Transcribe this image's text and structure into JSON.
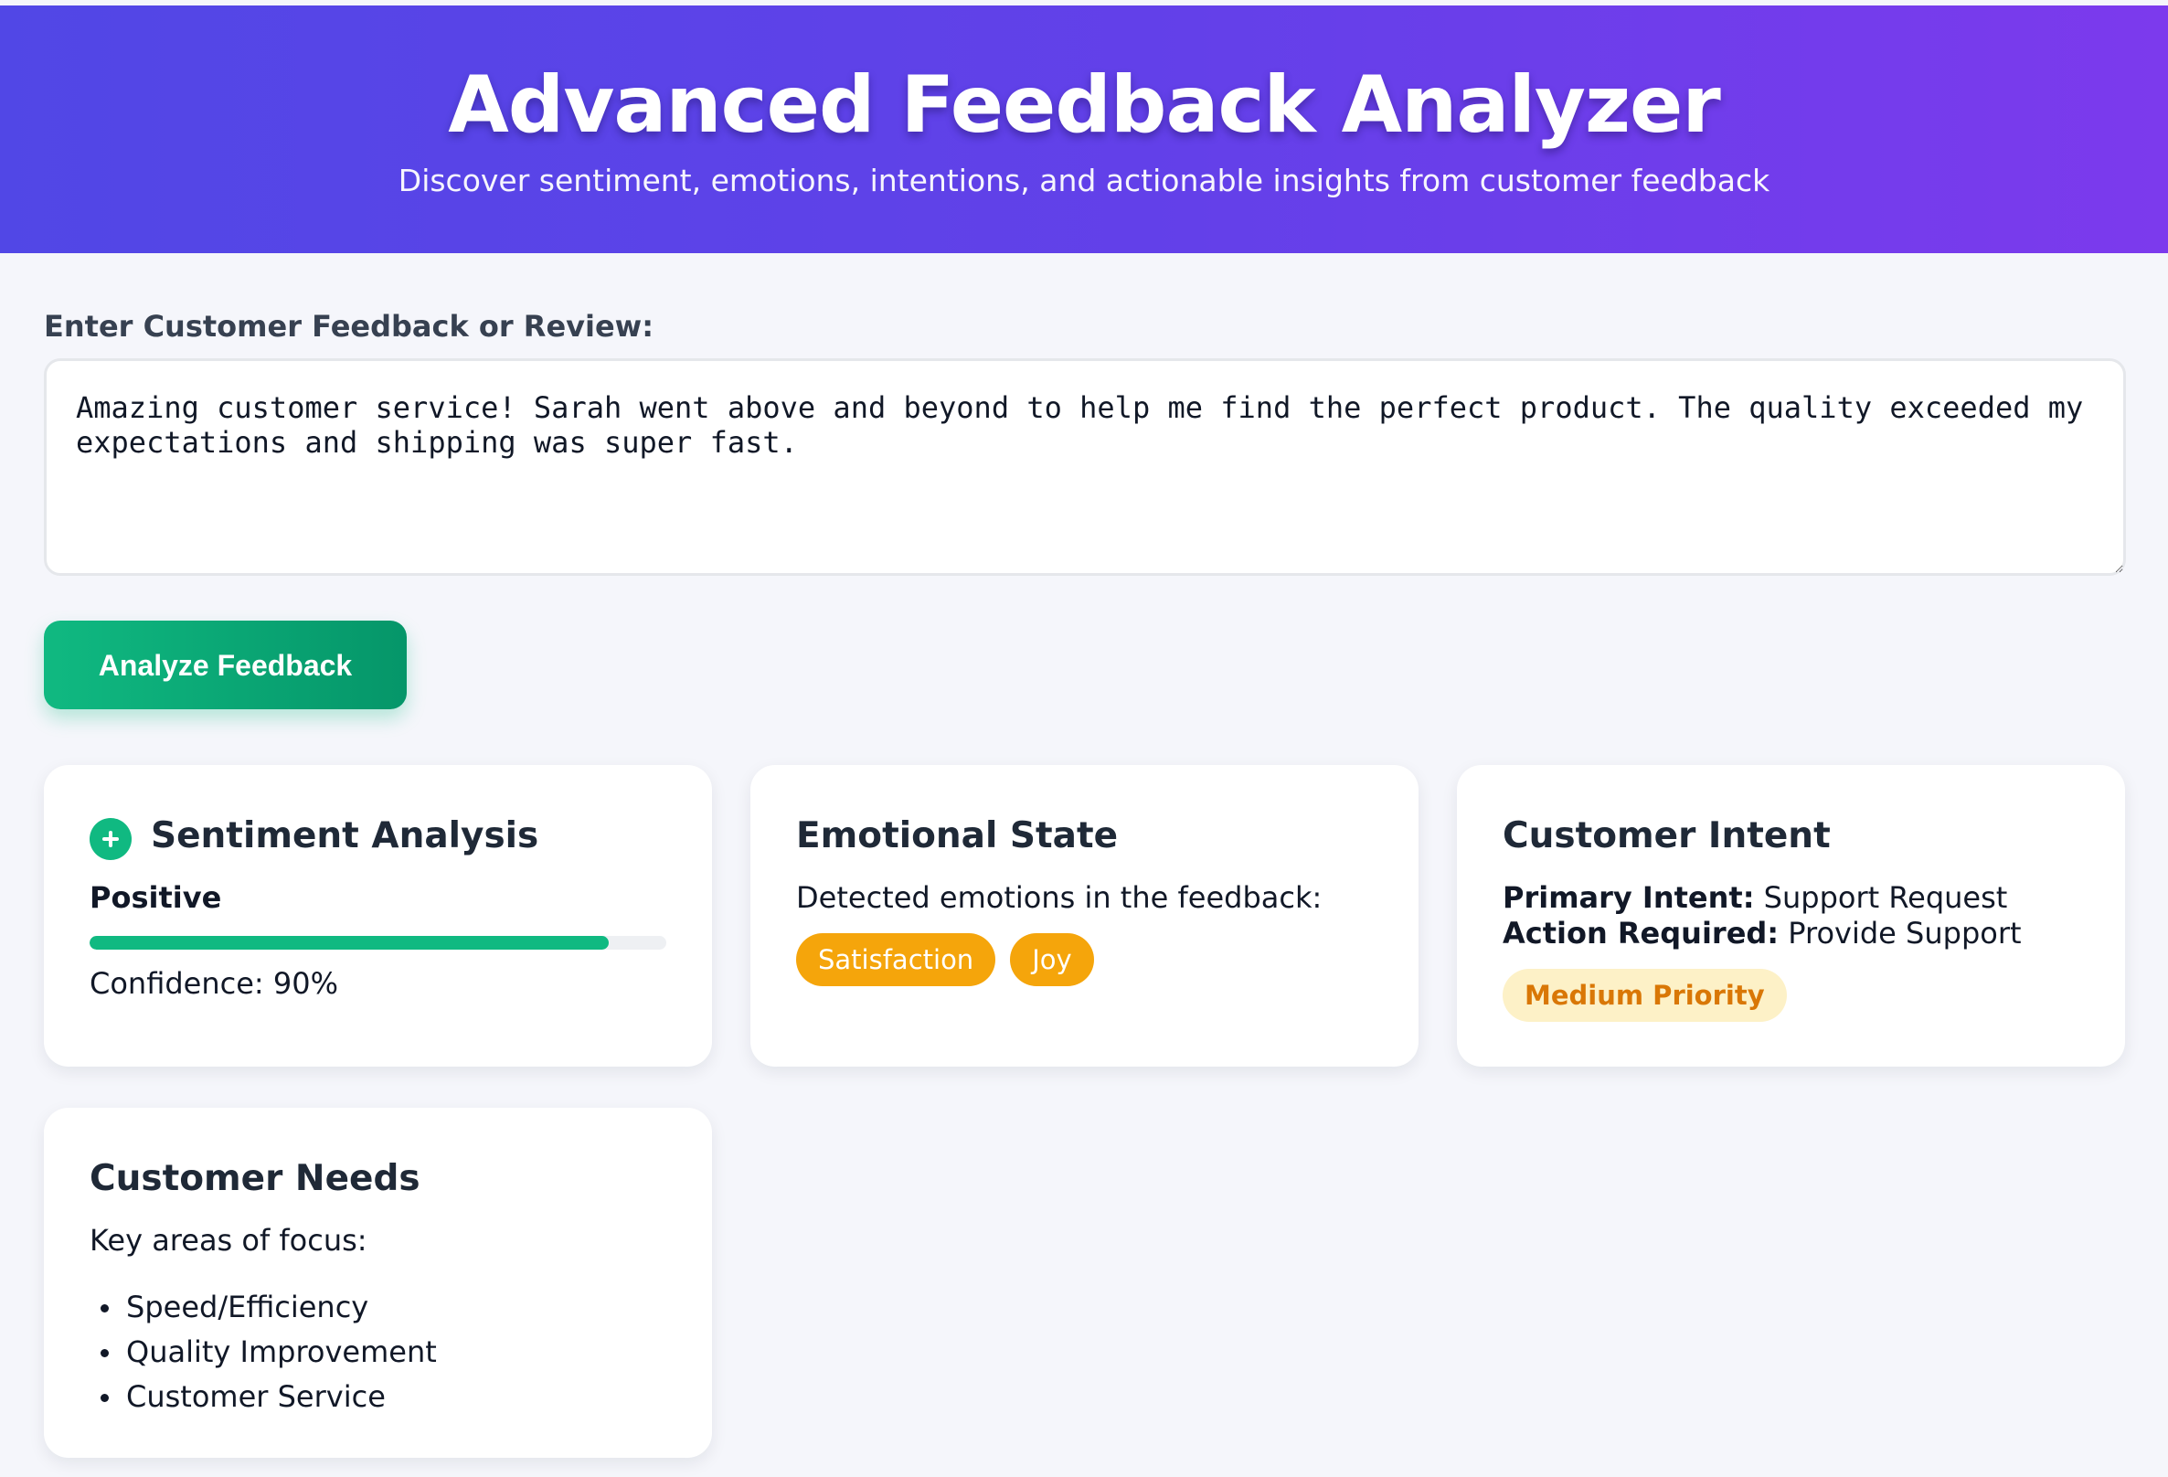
{
  "header": {
    "title": "Advanced Feedback Analyzer",
    "subtitle": "Discover sentiment, emotions, intentions, and actionable insights from customer feedback"
  },
  "feedback_form": {
    "label": "Enter Customer Feedback or Review:",
    "input_value": "Amazing customer service! Sarah went above and beyond to help me find the perfect product. The quality exceeded my expectations and shipping was super fast.",
    "analyze_button": "Analyze Feedback"
  },
  "results": {
    "sentiment": {
      "title": "Sentiment Analysis",
      "icon": "plus-icon",
      "label": "Positive",
      "confidence_text": "Confidence: 90%",
      "confidence": 0.9,
      "color": "#10b981"
    },
    "emotions": {
      "title": "Emotional State",
      "description": "Detected emotions in the feedback:",
      "tags": [
        "Satisfaction",
        "Joy"
      ],
      "tag_color": "#f5a50b"
    },
    "intent": {
      "title": "Customer Intent",
      "primary_label": "Primary Intent:",
      "primary_value": "Support Request",
      "action_label": "Action Required:",
      "action_value": "Provide Support",
      "priority": "Medium Priority",
      "priority_bg": "#fdf1c7",
      "priority_color": "#d97706"
    },
    "needs": {
      "title": "Customer Needs",
      "description": "Key areas of focus:",
      "items": [
        "Speed/Efficiency",
        "Quality Improvement",
        "Customer Service"
      ]
    }
  },
  "colors": {
    "header_gradient_start": "#5147e6",
    "header_gradient_end": "#7c3aed",
    "button_gradient_start": "#10b981",
    "button_gradient_end": "#059669",
    "page_background": "#f5f6fb"
  }
}
